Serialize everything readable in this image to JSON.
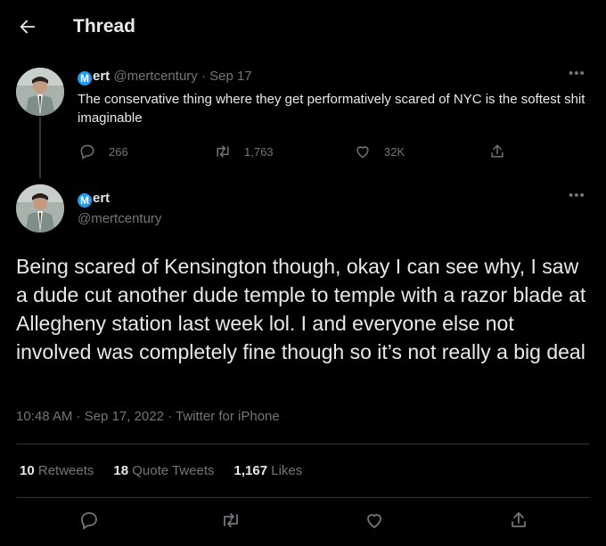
{
  "header": {
    "title": "Thread"
  },
  "tweet1": {
    "badge": "M",
    "name": "ert",
    "meta": "@mertcentury · Sep 17",
    "text": "The conservative thing where they get performatively scared of NYC is the softest shit imaginable",
    "replies": "266",
    "retweets": "1,763",
    "likes": "32K"
  },
  "tweet2": {
    "badge": "M",
    "name": "ert",
    "handle": "@mertcentury",
    "text": "Being scared of Kensington though, okay I can see why, I saw a dude cut another dude temple to temple with a razor blade at Allegheny station last week lol. I and everyone else not involved was completely fine though so it’s not really a big deal",
    "timestamp": "10:48 AM · Sep 17, 2022 · Twitter for iPhone",
    "retweets_count": "10",
    "retweets_label": "Retweets",
    "quotes_count": "18",
    "quotes_label": "Quote Tweets",
    "likes_count": "1,167",
    "likes_label": "Likes"
  },
  "colors": {
    "background": "#000000",
    "text_primary": "#e7e9ea",
    "text_secondary": "#71767b",
    "divider": "#2f3336",
    "accent": "#1d9bf0"
  },
  "icons": [
    "back-arrow-icon",
    "more-icon",
    "reply-icon",
    "retweet-icon",
    "like-icon",
    "share-icon"
  ]
}
